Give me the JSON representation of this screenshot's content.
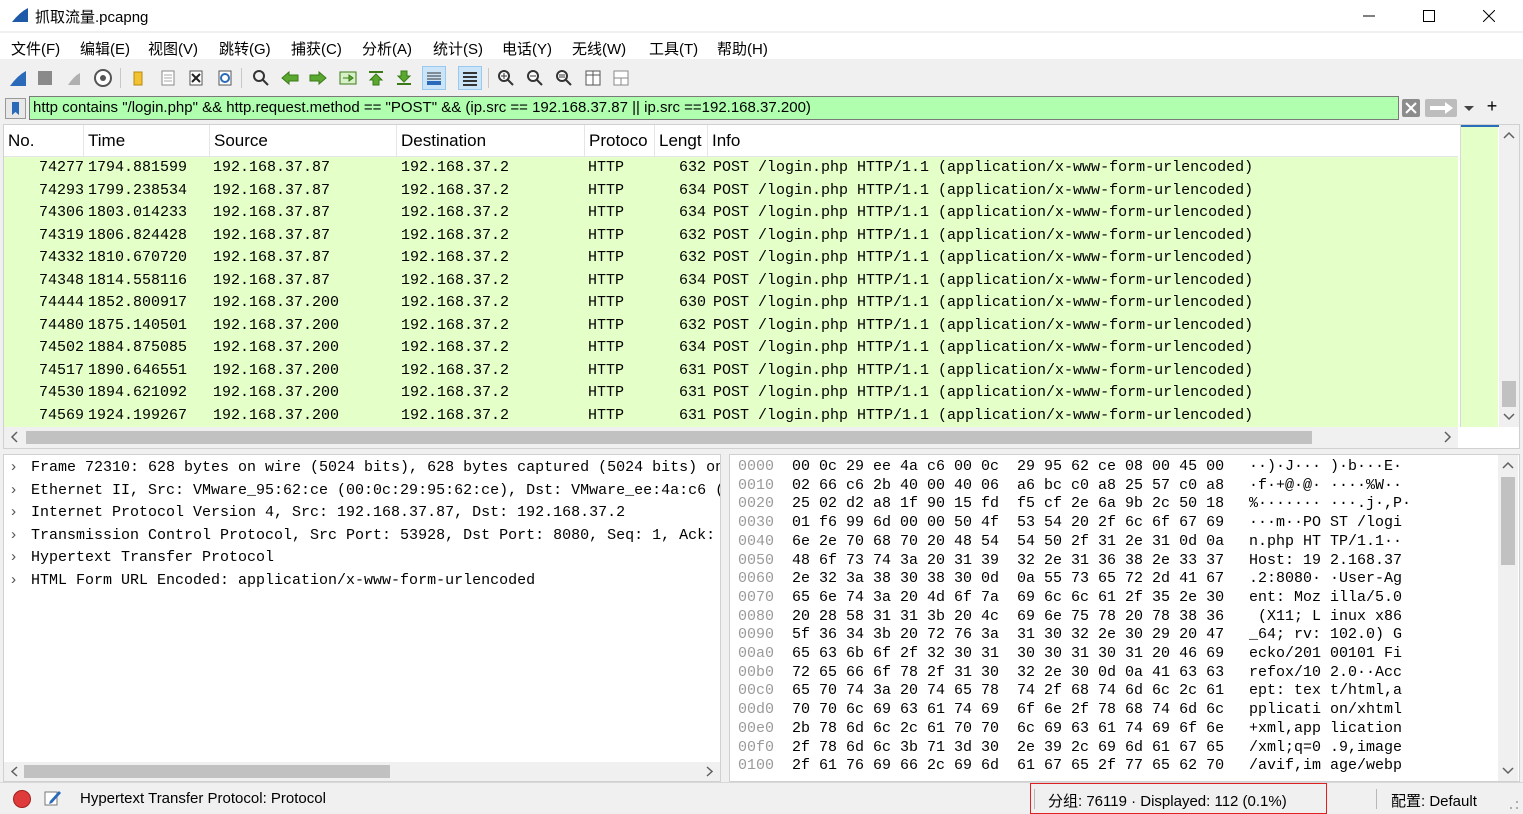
{
  "window": {
    "title": "抓取流量.pcapng"
  },
  "menu": [
    "文件(F)",
    "编辑(E)",
    "视图(V)",
    "跳转(G)",
    "捕获(C)",
    "分析(A)",
    "统计(S)",
    "电话(Y)",
    "无线(W)",
    "工具(T)",
    "帮助(H)"
  ],
  "filter": {
    "text": "http contains \"/login.php\" && http.request.method == \"POST\" && (ip.src == 192.168.37.87 ||  ip.src ==192.168.37.200)",
    "add_label": "+"
  },
  "packet_list": {
    "columns": {
      "no": "No.",
      "time": "Time",
      "source": "Source",
      "destination": "Destination",
      "protocol": "Protoco",
      "length": "Lengt",
      "info": "Info"
    },
    "rows": [
      {
        "no": "74277",
        "time": "1794.881599",
        "src": "192.168.37.87",
        "dst": "192.168.37.2",
        "proto": "HTTP",
        "len": "632",
        "info": "POST /login.php HTTP/1.1  (application/x-www-form-urlencoded)"
      },
      {
        "no": "74293",
        "time": "1799.238534",
        "src": "192.168.37.87",
        "dst": "192.168.37.2",
        "proto": "HTTP",
        "len": "634",
        "info": "POST /login.php HTTP/1.1  (application/x-www-form-urlencoded)"
      },
      {
        "no": "74306",
        "time": "1803.014233",
        "src": "192.168.37.87",
        "dst": "192.168.37.2",
        "proto": "HTTP",
        "len": "634",
        "info": "POST /login.php HTTP/1.1  (application/x-www-form-urlencoded)"
      },
      {
        "no": "74319",
        "time": "1806.824428",
        "src": "192.168.37.87",
        "dst": "192.168.37.2",
        "proto": "HTTP",
        "len": "632",
        "info": "POST /login.php HTTP/1.1  (application/x-www-form-urlencoded)"
      },
      {
        "no": "74332",
        "time": "1810.670720",
        "src": "192.168.37.87",
        "dst": "192.168.37.2",
        "proto": "HTTP",
        "len": "632",
        "info": "POST /login.php HTTP/1.1  (application/x-www-form-urlencoded)"
      },
      {
        "no": "74348",
        "time": "1814.558116",
        "src": "192.168.37.87",
        "dst": "192.168.37.2",
        "proto": "HTTP",
        "len": "634",
        "info": "POST /login.php HTTP/1.1  (application/x-www-form-urlencoded)"
      },
      {
        "no": "74444",
        "time": "1852.800917",
        "src": "192.168.37.200",
        "dst": "192.168.37.2",
        "proto": "HTTP",
        "len": "630",
        "info": "POST /login.php HTTP/1.1  (application/x-www-form-urlencoded)"
      },
      {
        "no": "74480",
        "time": "1875.140501",
        "src": "192.168.37.200",
        "dst": "192.168.37.2",
        "proto": "HTTP",
        "len": "632",
        "info": "POST /login.php HTTP/1.1  (application/x-www-form-urlencoded)"
      },
      {
        "no": "74502",
        "time": "1884.875085",
        "src": "192.168.37.200",
        "dst": "192.168.37.2",
        "proto": "HTTP",
        "len": "634",
        "info": "POST /login.php HTTP/1.1  (application/x-www-form-urlencoded)"
      },
      {
        "no": "74517",
        "time": "1890.646551",
        "src": "192.168.37.200",
        "dst": "192.168.37.2",
        "proto": "HTTP",
        "len": "631",
        "info": "POST /login.php HTTP/1.1  (application/x-www-form-urlencoded)"
      },
      {
        "no": "74530",
        "time": "1894.621092",
        "src": "192.168.37.200",
        "dst": "192.168.37.2",
        "proto": "HTTP",
        "len": "631",
        "info": "POST /login.php HTTP/1.1  (application/x-www-form-urlencoded)"
      },
      {
        "no": "74569",
        "time": "1924.199267",
        "src": "192.168.37.200",
        "dst": "192.168.37.2",
        "proto": "HTTP",
        "len": "631",
        "info": "POST /login.php HTTP/1.1  (application/x-www-form-urlencoded)"
      }
    ],
    "row_color": "#e4ffc7"
  },
  "details": [
    "Frame 72310: 628 bytes on wire (5024 bits), 628 bytes captured (5024 bits) on",
    "Ethernet II, Src: VMware_95:62:ce (00:0c:29:95:62:ce), Dst: VMware_ee:4a:c6 (0",
    "Internet Protocol Version 4, Src: 192.168.37.87, Dst: 192.168.37.2",
    "Transmission Control Protocol, Src Port: 53928, Dst Port: 8080, Seq: 1, Ack: 1",
    "Hypertext Transfer Protocol",
    "HTML Form URL Encoded: application/x-www-form-urlencoded"
  ],
  "bytes": [
    {
      "off": "0000",
      "hex": "00 0c 29 ee 4a c6 00 0c  29 95 62 ce 08 00 45 00",
      "ascii": "··)·J··· )·b···E·"
    },
    {
      "off": "0010",
      "hex": "02 66 c6 2b 40 00 40 06  a6 bc c0 a8 25 57 c0 a8",
      "ascii": "·f·+@·@· ····%W··"
    },
    {
      "off": "0020",
      "hex": "25 02 d2 a8 1f 90 15 fd  f5 cf 2e 6a 9b 2c 50 18",
      "ascii": "%······· ···.j·,P·"
    },
    {
      "off": "0030",
      "hex": "01 f6 99 6d 00 00 50 4f  53 54 20 2f 6c 6f 67 69",
      "ascii": "···m··PO ST /logi"
    },
    {
      "off": "0040",
      "hex": "6e 2e 70 68 70 20 48 54  54 50 2f 31 2e 31 0d 0a",
      "ascii": "n.php HT TP/1.1··"
    },
    {
      "off": "0050",
      "hex": "48 6f 73 74 3a 20 31 39  32 2e 31 36 38 2e 33 37",
      "ascii": "Host: 19 2.168.37"
    },
    {
      "off": "0060",
      "hex": "2e 32 3a 38 30 38 30 0d  0a 55 73 65 72 2d 41 67",
      "ascii": ".2:8080· ·User-Ag"
    },
    {
      "off": "0070",
      "hex": "65 6e 74 3a 20 4d 6f 7a  69 6c 6c 61 2f 35 2e 30",
      "ascii": "ent: Moz illa/5.0"
    },
    {
      "off": "0080",
      "hex": "20 28 58 31 31 3b 20 4c  69 6e 75 78 20 78 38 36",
      "ascii": " (X11; L inux x86"
    },
    {
      "off": "0090",
      "hex": "5f 36 34 3b 20 72 76 3a  31 30 32 2e 30 29 20 47",
      "ascii": "_64; rv: 102.0) G"
    },
    {
      "off": "00a0",
      "hex": "65 63 6b 6f 2f 32 30 31  30 30 31 30 31 20 46 69",
      "ascii": "ecko/201 00101 Fi"
    },
    {
      "off": "00b0",
      "hex": "72 65 66 6f 78 2f 31 30  32 2e 30 0d 0a 41 63 63",
      "ascii": "refox/10 2.0··Acc"
    },
    {
      "off": "00c0",
      "hex": "65 70 74 3a 20 74 65 78  74 2f 68 74 6d 6c 2c 61",
      "ascii": "ept: tex t/html,a"
    },
    {
      "off": "00d0",
      "hex": "70 70 6c 69 63 61 74 69  6f 6e 2f 78 68 74 6d 6c",
      "ascii": "pplicati on/xhtml"
    },
    {
      "off": "00e0",
      "hex": "2b 78 6d 6c 2c 61 70 70  6c 69 63 61 74 69 6f 6e",
      "ascii": "+xml,app lication"
    },
    {
      "off": "00f0",
      "hex": "2f 78 6d 6c 3b 71 3d 30  2e 39 2c 69 6d 61 67 65",
      "ascii": "/xml;q=0 .9,image"
    },
    {
      "off": "0100",
      "hex": "2f 61 76 69 66 2c 69 6d  61 67 65 2f 77 65 62 70",
      "ascii": "/avif,im age/webp"
    }
  ],
  "status": {
    "field": "Hypertext Transfer Protocol: Protocol",
    "packets": "分组: 76119 · Displayed: 112 (0.1%)",
    "profile": "配置:  Default"
  },
  "colors": {
    "filter_valid": "#afffaf",
    "row_http": "#e4ffc7",
    "highlight_box": "#e02020"
  }
}
